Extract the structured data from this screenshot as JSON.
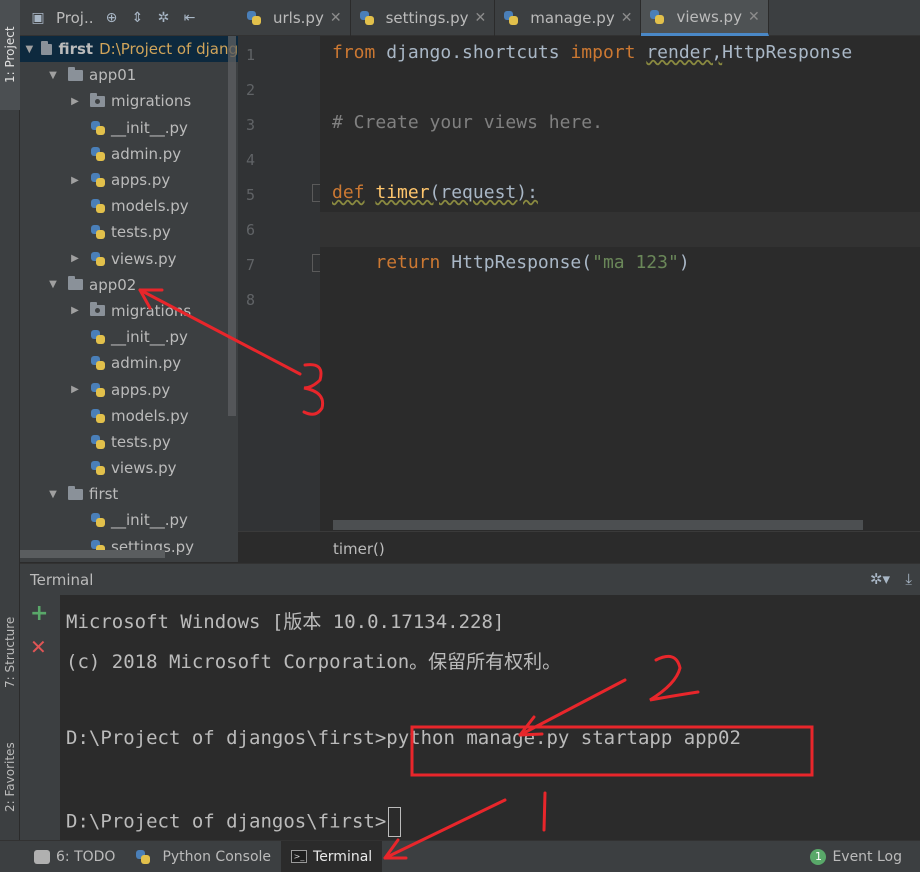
{
  "left_strip": {
    "project_tab": "1: Project",
    "structure_tab": "7: Structure",
    "favorites_tab": "2: Favorites"
  },
  "project_panel": {
    "title": "Proj..",
    "header_icons": [
      "project-view-icon",
      "locate-icon",
      "collapse-all-icon",
      "gear-icon",
      "hide-icon"
    ],
    "tree": [
      {
        "label": "first",
        "path": "D:\\Project of djang",
        "type": "root-folder",
        "expanded": true
      },
      {
        "label": "app01",
        "type": "folder",
        "expanded": true
      },
      {
        "label": "migrations",
        "type": "package",
        "expanded": false
      },
      {
        "label": "__init__.py",
        "type": "py"
      },
      {
        "label": "admin.py",
        "type": "py"
      },
      {
        "label": "apps.py",
        "type": "py",
        "expandable": true
      },
      {
        "label": "models.py",
        "type": "py"
      },
      {
        "label": "tests.py",
        "type": "py"
      },
      {
        "label": "views.py",
        "type": "py",
        "expandable": true
      },
      {
        "label": "app02",
        "type": "folder",
        "expanded": true
      },
      {
        "label": "migrations",
        "type": "package",
        "expanded": false
      },
      {
        "label": "__init__.py",
        "type": "py"
      },
      {
        "label": "admin.py",
        "type": "py"
      },
      {
        "label": "apps.py",
        "type": "py",
        "expandable": true
      },
      {
        "label": "models.py",
        "type": "py"
      },
      {
        "label": "tests.py",
        "type": "py"
      },
      {
        "label": "views.py",
        "type": "py"
      },
      {
        "label": "first",
        "type": "folder",
        "expanded": true
      },
      {
        "label": "__init__.py",
        "type": "py"
      },
      {
        "label": "settings.py",
        "type": "py"
      }
    ]
  },
  "editor": {
    "tabs": [
      {
        "label": "urls.py",
        "active": false
      },
      {
        "label": "settings.py",
        "active": false
      },
      {
        "label": "manage.py",
        "active": false
      },
      {
        "label": "views.py",
        "active": true
      }
    ],
    "line_numbers": [
      "1",
      "2",
      "3",
      "4",
      "5",
      "6",
      "7",
      "8"
    ],
    "code": {
      "l1_kw1": "from",
      "l1_mid": " django.shortcuts ",
      "l1_kw2": "import",
      "l1_sp": " ",
      "l1_render": "render,",
      "l1_rest": "HttpResponse",
      "l3": "# Create your views here.",
      "l5_kw": "def",
      "l5_sp": " ",
      "l5_fn": "timer",
      "l5_rest": "(request):",
      "l7_indent": "    ",
      "l7_kw": "return",
      "l7_mid": " HttpResponse(",
      "l7_str": "\"ma 123\"",
      "l7_end": ")"
    },
    "breadcrumb": "timer()"
  },
  "terminal": {
    "title": "Terminal",
    "lines": {
      "l1": "Microsoft Windows [版本 10.0.17134.228]",
      "l2": "(c) 2018 Microsoft Corporation。保留所有权利。",
      "l4_prompt": "D:\\Project of djangos\\first>",
      "l4_cmd": "python manage.py startapp app02",
      "l6_prompt": "D:\\Project of djangos\\first>"
    }
  },
  "bottom_bar": {
    "todo": "6: TODO",
    "python_console": "Python Console",
    "terminal": "Terminal",
    "event_log": "Event Log",
    "event_count": "1"
  },
  "annotations": {
    "color": "#e8262b",
    "marks": [
      "3",
      "2",
      "1"
    ]
  }
}
